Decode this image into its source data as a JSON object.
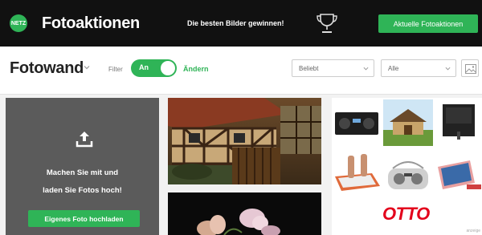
{
  "topbar": {
    "logo_text": "NETZ",
    "brand": "Fotoaktionen",
    "tagline": "Die besten Bilder gewinnen!",
    "cta_label": "Aktuelle Fotoaktionen",
    "accent": "#2fb457"
  },
  "toolbar": {
    "title": "Fotowand",
    "filter_label": "Filter",
    "toggle_label": "An",
    "change_label": "Ändern",
    "sort_select": "Beliebt",
    "category_select": "Alle"
  },
  "upload": {
    "line1": "Machen Sie mit und",
    "line2": "laden Sie Fotos hoch!",
    "button_label": "Eigenes Foto hochladen"
  },
  "ad": {
    "brand": "OTTO",
    "tag": "anzeige"
  }
}
